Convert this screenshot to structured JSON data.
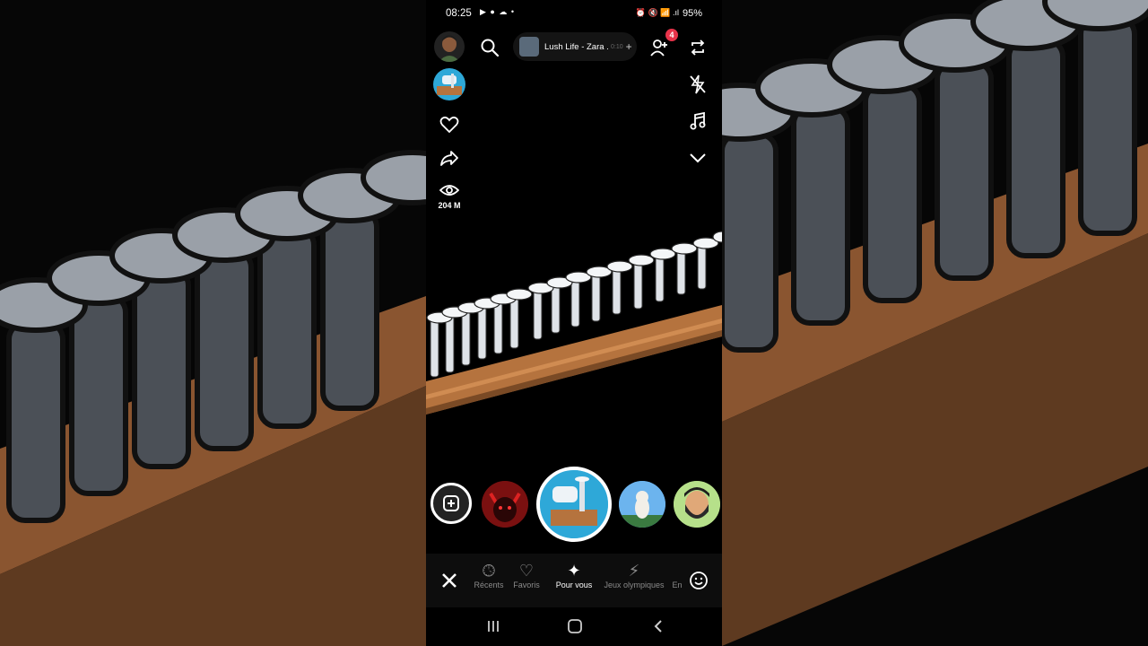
{
  "status_bar": {
    "time": "08:25",
    "left_icons": "▶ ● ☁ •",
    "right_icons": "⏰ 🔇 📶 .ıl",
    "battery": "95%"
  },
  "top_bar": {
    "music_title": "Lush Life - Zara ...",
    "music_duration": "0:10",
    "music_add": "+",
    "friend_badge_count": "4"
  },
  "side_actions": {
    "views_count": "204 M"
  },
  "bottom_tabs": [
    {
      "label": "Récents",
      "icon": "history-icon",
      "active": false
    },
    {
      "label": "Favoris",
      "icon": "heart-icon",
      "active": false
    },
    {
      "label": "Pour vous",
      "icon": "sparkle-icon",
      "active": true
    },
    {
      "label": "Jeux olympiques",
      "icon": "olympics-icon",
      "active": false
    },
    {
      "label": "En",
      "icon": "more-icon",
      "active": false
    }
  ],
  "colors": {
    "background": "#000000",
    "badge": "#e8334a",
    "wood": "#b5733e",
    "nail": "#d9dde3",
    "selected_ring": "#ffffff"
  }
}
